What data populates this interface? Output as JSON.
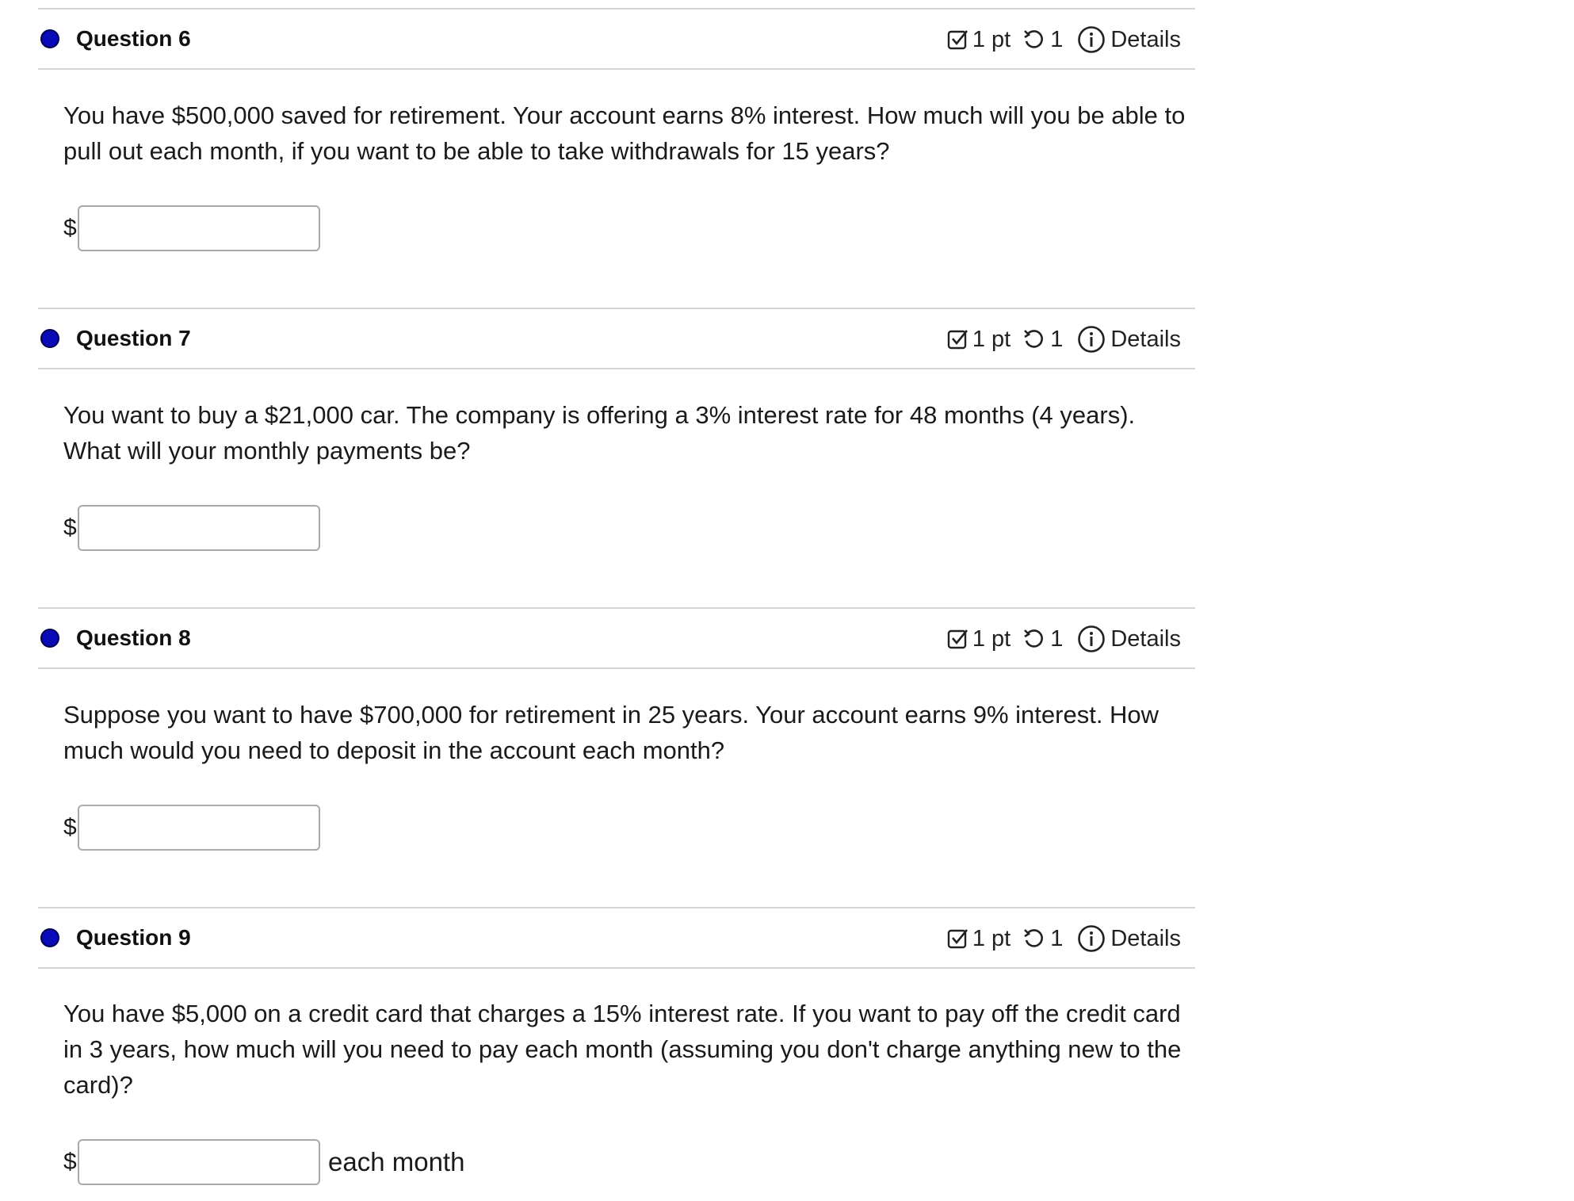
{
  "questions": [
    {
      "title": "Question 6",
      "points": "1 pt",
      "attempts": "1",
      "details": "Details",
      "text": "You have $500,000 saved for retirement. Your account earns 8% interest. How much will you be able to pull out each month, if you want to be able to take withdrawals for 15 years?",
      "currency": "$",
      "answer": "",
      "suffix": ""
    },
    {
      "title": "Question 7",
      "points": "1 pt",
      "attempts": "1",
      "details": "Details",
      "text": "You want to buy a $21,000 car. The company is offering a 3% interest rate for 48 months (4 years). What will your monthly payments be?",
      "currency": "$",
      "answer": "",
      "suffix": ""
    },
    {
      "title": "Question 8",
      "points": "1 pt",
      "attempts": "1",
      "details": "Details",
      "text": "Suppose you want to have $700,000 for retirement in 25 years. Your account earns 9% interest. How much would you need to deposit in the account each month?",
      "currency": "$",
      "answer": "",
      "suffix": ""
    },
    {
      "title": "Question 9",
      "points": "1 pt",
      "attempts": "1",
      "details": "Details",
      "text": "You have $5,000 on a credit card that charges a 15% interest rate. If you want to pay off the credit card in 3 years, how much will you need to pay each month (assuming you don't charge anything new to the card)?",
      "currency": "$",
      "answer": "",
      "suffix": "each month"
    }
  ],
  "colors": {
    "status_dot": "#0a0ab8",
    "divider": "#d4d4d4",
    "input_border": "#a9a9a9"
  }
}
